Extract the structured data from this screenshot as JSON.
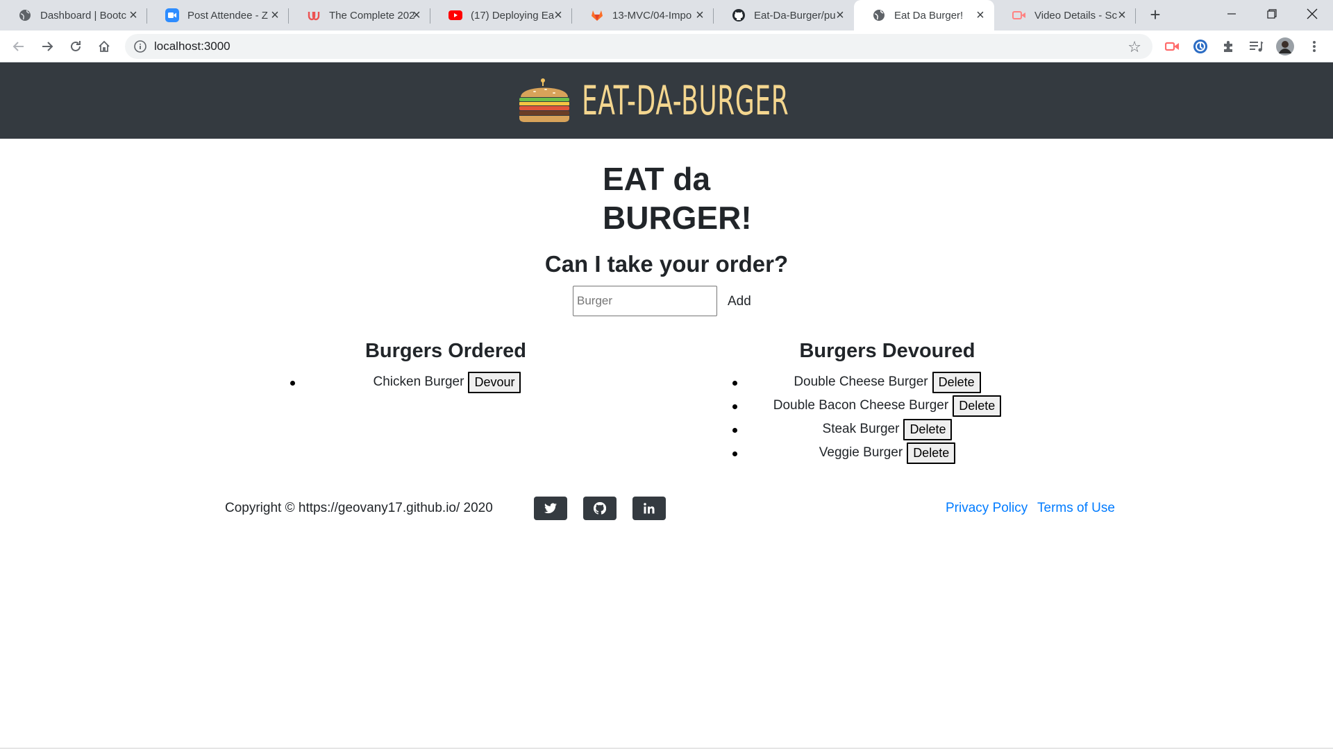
{
  "browser": {
    "tabs": [
      {
        "title": "Dashboard | Bootc",
        "icon": "globe-icon"
      },
      {
        "title": "Post Attendee - Z",
        "icon": "zoom-icon"
      },
      {
        "title": "The Complete 202",
        "icon": "udemy-icon"
      },
      {
        "title": "(17) Deploying Ea",
        "icon": "youtube-icon"
      },
      {
        "title": "13-MVC/04-Impo",
        "icon": "gitlab-icon"
      },
      {
        "title": "Eat-Da-Burger/pu",
        "icon": "github-icon"
      },
      {
        "title": "Eat Da Burger!",
        "icon": "globe-icon",
        "active": true
      },
      {
        "title": "Video Details - Sc",
        "icon": "screencastify-icon"
      }
    ],
    "url": "localhost:3000"
  },
  "navbar": {
    "brand_text": "EAT-DA-BURGER",
    "brand_color": "#f4d68f",
    "background": "#343a40"
  },
  "page": {
    "headline_line1": "EAT da",
    "headline_line2": "BURGER!",
    "order_question": "Can I take your order?",
    "input_placeholder": "Burger",
    "add_label": "Add"
  },
  "ordered": {
    "heading": "Burgers Ordered",
    "button_label": "Devour",
    "items": [
      "Chicken Burger"
    ]
  },
  "devoured": {
    "heading": "Burgers Devoured",
    "button_label": "Delete",
    "items": [
      "Double Cheese Burger",
      "Double Bacon Cheese Burger",
      "Steak Burger",
      "Veggie Burger"
    ]
  },
  "footer": {
    "copyright": "Copyright © https://geovany17.github.io/ 2020",
    "social": [
      "twitter-icon",
      "github-icon",
      "linkedin-icon"
    ],
    "links": [
      "Privacy Policy",
      "Terms of Use"
    ],
    "link_color": "#007bff"
  }
}
